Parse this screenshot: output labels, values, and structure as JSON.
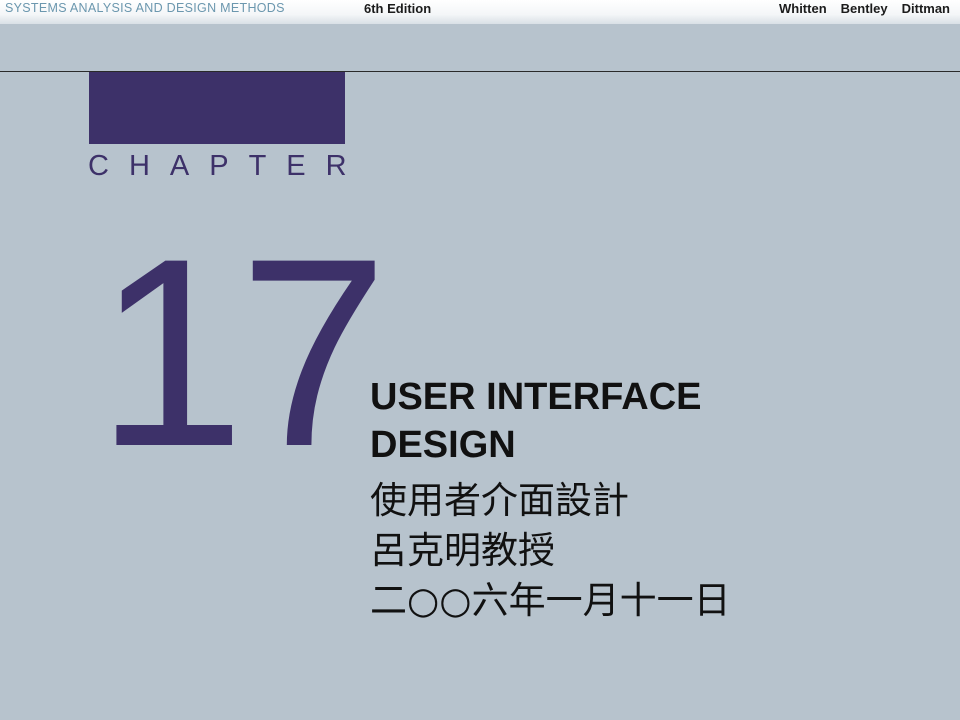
{
  "header": {
    "book_title": "SYSTEMS ANALYSIS AND DESIGN METHODS",
    "edition": "6th Edition",
    "authors": [
      "Whitten",
      "Bentley",
      "Dittman"
    ]
  },
  "slide": {
    "chapter_label": "CHAPTER",
    "chapter_number": "17",
    "title_line1": "USER INTERFACE",
    "title_line2": "DESIGN",
    "title_cn": "使用者介面設計",
    "instructor": "呂克明教授",
    "date": "二○○六年一月十一日"
  },
  "colors": {
    "background": "#b7c3cd",
    "accent": "#3d3169",
    "header_title": "#6b97ae"
  }
}
